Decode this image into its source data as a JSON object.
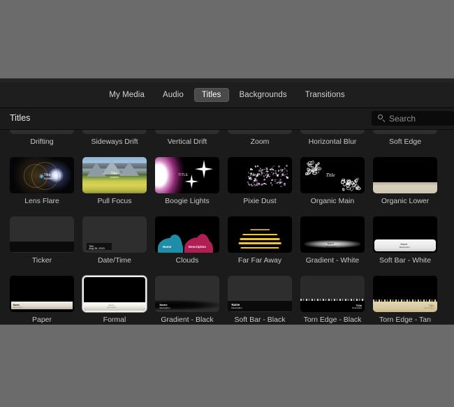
{
  "window": {
    "backdrop_color": "#6b6b6b",
    "panel_color": "#1b1b1b"
  },
  "tabs": [
    {
      "id": "my-media",
      "label": "My Media",
      "active": false
    },
    {
      "id": "audio",
      "label": "Audio",
      "active": false
    },
    {
      "id": "titles",
      "label": "Titles",
      "active": true
    },
    {
      "id": "backgrounds",
      "label": "Backgrounds",
      "active": false
    },
    {
      "id": "transitions",
      "label": "Transitions",
      "active": false
    }
  ],
  "header": {
    "title": "Titles"
  },
  "search": {
    "placeholder": "Search",
    "value": "",
    "icon": "search-icon"
  },
  "annotation": {
    "shape": "ellipse",
    "color": "#e01b1b",
    "targets": "Formal"
  },
  "grid": {
    "selected": "Formal",
    "items": [
      {
        "label": "Drifting",
        "art": "placeholder"
      },
      {
        "label": "Sideways Drift",
        "art": "placeholder"
      },
      {
        "label": "Vertical Drift",
        "art": "placeholder"
      },
      {
        "label": "Zoom",
        "art": "placeholder"
      },
      {
        "label": "Horizontal Blur",
        "art": "placeholder"
      },
      {
        "label": "Soft Edge",
        "art": "placeholder"
      },
      {
        "label": "Lens Flare",
        "art": "lensflare",
        "title_text": "Title",
        "sub_text": "Subtitle"
      },
      {
        "label": "Pull Focus",
        "art": "pullfocus",
        "title_text": "Title",
        "sub_text": "Subtitle"
      },
      {
        "label": "Boogie Lights",
        "art": "boogie",
        "title_text": "TITLE"
      },
      {
        "label": "Pixie Dust",
        "art": "pixie",
        "title_text": "Title"
      },
      {
        "label": "Organic Main",
        "art": "organic",
        "title_text": "Title"
      },
      {
        "label": "Organic Lower",
        "art": "organiclower"
      },
      {
        "label": "Ticker",
        "art": "softblack"
      },
      {
        "label": "Date/Time",
        "art": "datetime",
        "title_text": "Title",
        "sub_text": "Aug 26, 2019"
      },
      {
        "label": "Clouds",
        "art": "clouds",
        "title_text": "Name",
        "sub_text": "Description"
      },
      {
        "label": "Far Far Away",
        "art": "farfar",
        "title_text": "LOREM IPSUM"
      },
      {
        "label": "Gradient - White",
        "art": "gradwhite",
        "title_text": "Name",
        "sub_text": "Description"
      },
      {
        "label": "Soft Bar - White",
        "art": "softwhite",
        "title_text": "Name",
        "sub_text": "Description"
      },
      {
        "label": "Paper",
        "art": "paper",
        "title_text": "Name",
        "sub_text": "Description"
      },
      {
        "label": "Formal",
        "art": "formal",
        "title_text": "Name",
        "sub_text": "Description"
      },
      {
        "label": "Gradient - Black",
        "art": "gradblack",
        "title_text": "Name",
        "sub_text": "Description"
      },
      {
        "label": "Soft Bar - Black",
        "art": "softblack2",
        "title_text": "Name",
        "sub_text": "Description"
      },
      {
        "label": "Torn Edge - Black",
        "art": "tornblack",
        "title_text": "Title",
        "sub_text": "Description"
      },
      {
        "label": "Torn Edge - Tan",
        "art": "torntan",
        "title_text": "Title",
        "sub_text": "Description"
      }
    ]
  }
}
